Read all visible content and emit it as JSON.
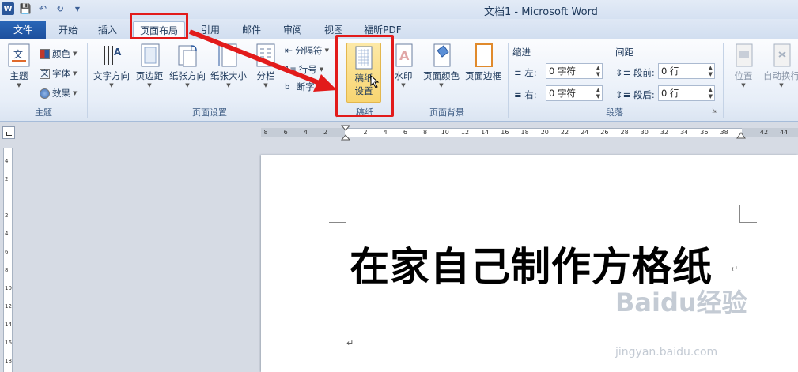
{
  "window": {
    "title": "文档1 - Microsoft Word"
  },
  "qat": {
    "logo": "W",
    "icons": [
      "save-icon",
      "undo-icon",
      "redo-icon",
      "customize-qat-icon"
    ]
  },
  "tabs": [
    {
      "label": "文件"
    },
    {
      "label": "开始"
    },
    {
      "label": "插入"
    },
    {
      "label": "页面布局"
    },
    {
      "label": "引用"
    },
    {
      "label": "邮件"
    },
    {
      "label": "审阅"
    },
    {
      "label": "视图"
    },
    {
      "label": "福昕PDF"
    }
  ],
  "ribbon": {
    "theme": {
      "group_label": "主题",
      "themes_label": "主题",
      "colors_label": "颜色",
      "fonts_label": "字体",
      "effects_label": "效果"
    },
    "page_setup": {
      "group_label": "页面设置",
      "text_direction": "文字方向",
      "margins": "页边距",
      "orientation": "纸张方向",
      "size": "纸张大小",
      "columns": "分栏",
      "breaks": "分隔符",
      "line_numbers": "行号",
      "hyphenation": "断字"
    },
    "manuscript": {
      "group_label": "稿纸",
      "button_line1": "稿纸",
      "button_line2": "设置"
    },
    "page_background": {
      "group_label": "页面背景",
      "watermark": "水印",
      "page_color": "页面颜色",
      "page_borders": "页面边框"
    },
    "paragraph": {
      "group_label": "段落",
      "indent_label": "缩进",
      "indent_left_label": "左:",
      "indent_left_value": "0 字符",
      "indent_right_label": "右:",
      "indent_right_value": "0 字符",
      "spacing_label": "间距",
      "spacing_before_label": "段前:",
      "spacing_before_value": "0 行",
      "spacing_after_label": "段后:",
      "spacing_after_value": "0 行"
    },
    "arrange": {
      "position": "位置",
      "wrap_text": "自动换行"
    }
  },
  "ruler": {
    "ticks": [
      "8",
      "6",
      "4",
      "2",
      "2",
      "4",
      "6",
      "8",
      "10",
      "12",
      "14",
      "16",
      "18",
      "20",
      "22",
      "24",
      "26",
      "28",
      "30",
      "32",
      "34",
      "36",
      "38",
      "42",
      "44"
    ],
    "vticks": [
      "4",
      "2",
      "2",
      "4",
      "6",
      "8",
      "10",
      "12",
      "14",
      "16",
      "18"
    ]
  },
  "document": {
    "heading": "在家自己制作方格纸",
    "para_mark": "↵"
  },
  "watermark": {
    "brand": "Baidu经验",
    "url": "jingyan.baidu.com"
  },
  "colors": {
    "annotation_red": "#e21b1b",
    "file_tab_blue": "#2a67b8"
  }
}
